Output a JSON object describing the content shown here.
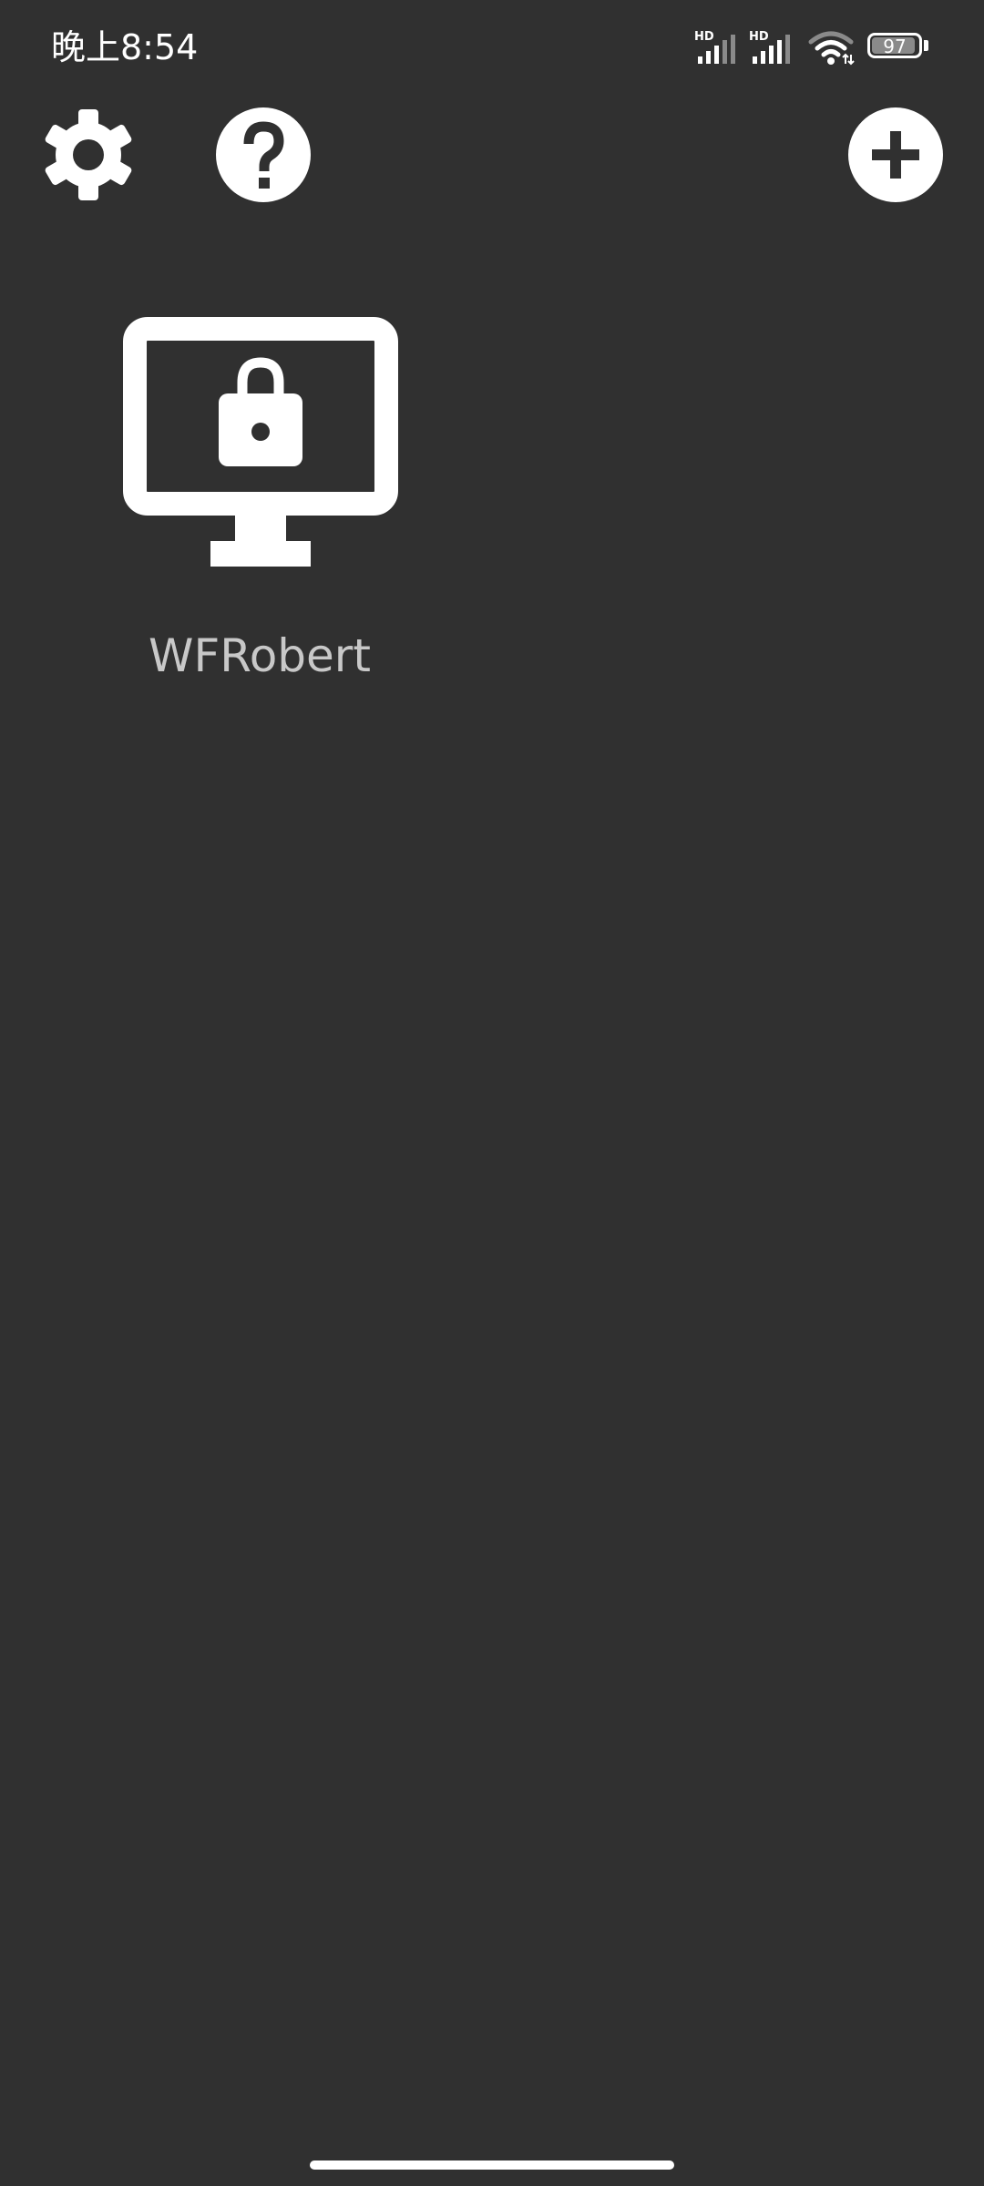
{
  "status_bar": {
    "time": "晚上8:54",
    "signal_1_label": "HD",
    "signal_2_label": "HD",
    "battery_level": "97",
    "battery_fraction": 0.97
  },
  "toolbar": {
    "settings_icon": "gear-icon",
    "help_icon": "question-circle-icon",
    "add_icon": "plus-circle-icon"
  },
  "devices": [
    {
      "name": "WFRobert",
      "icon": "locked-monitor-icon"
    }
  ],
  "colors": {
    "background": "#303030",
    "icon": "#ffffff",
    "label": "#c8c8c8"
  }
}
